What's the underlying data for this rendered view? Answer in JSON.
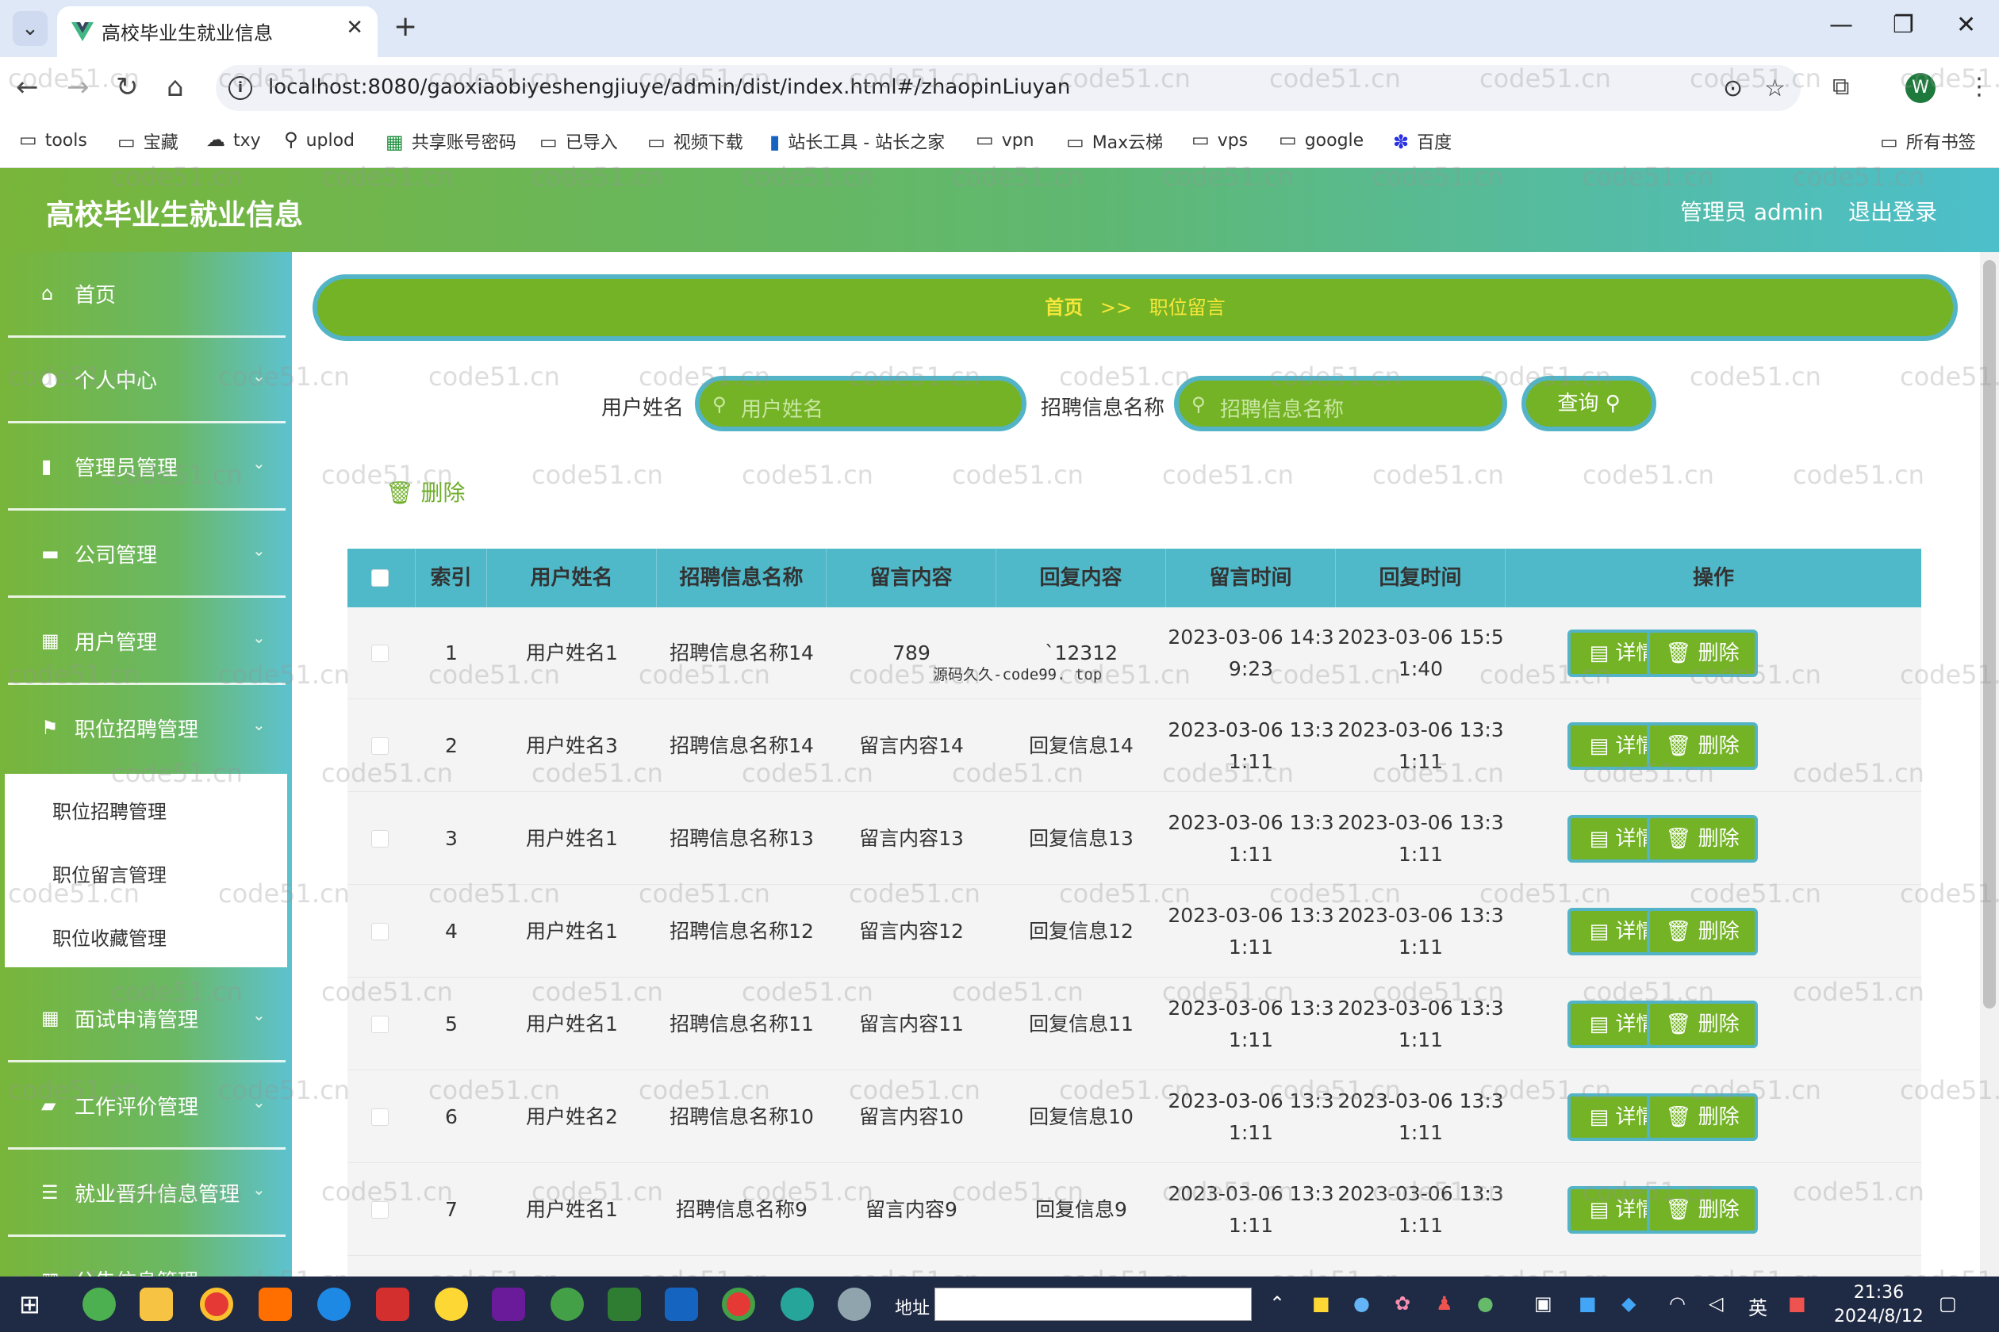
{
  "browser": {
    "tab_title": "高校毕业生就业信息",
    "url": "localhost:8080/gaoxiaobiyeshengjiuye/admin/dist/index.html#/zhaopinLiuyan",
    "bookmarks": [
      "tools",
      "宝藏",
      "txy",
      "uplod",
      "共享账号密码",
      "已导入",
      "视频下载",
      "站长工具 - 站长之家",
      "vpn",
      "Max云梯",
      "vps",
      "google",
      "百度"
    ],
    "all_bookmarks": "所有书签",
    "profile_initial": "W"
  },
  "header": {
    "title": "高校毕业生就业信息",
    "admin_label": "管理员 admin",
    "logout": "退出登录"
  },
  "sidebar": {
    "items": [
      {
        "label": "首页",
        "icon": "home-icon"
      },
      {
        "label": "个人中心",
        "icon": "user-icon"
      },
      {
        "label": "管理员管理",
        "icon": "bar-chart-icon"
      },
      {
        "label": "公司管理",
        "icon": "monitor-icon"
      },
      {
        "label": "用户管理",
        "icon": "grid-icon"
      },
      {
        "label": "职位招聘管理",
        "icon": "flag-icon"
      },
      {
        "label": "面试申请管理",
        "icon": "grid-icon"
      },
      {
        "label": "工作评价管理",
        "icon": "ticket-icon"
      },
      {
        "label": "就业晋升信息管理",
        "icon": "list-icon"
      },
      {
        "label": "公告信息管理",
        "icon": "grid-icon"
      }
    ],
    "submenu": [
      "职位招聘管理",
      "职位留言管理",
      "职位收藏管理"
    ]
  },
  "breadcrumb": {
    "home": "首页",
    "separator": ">>",
    "current": "职位留言"
  },
  "search": {
    "user_label": "用户姓名",
    "user_placeholder": "用户姓名",
    "job_label": "招聘信息名称",
    "job_placeholder": "招聘信息名称",
    "query_label": "查询"
  },
  "toolbar": {
    "delete_label": "删除"
  },
  "table": {
    "headers": [
      "索引",
      "用户姓名",
      "招聘信息名称",
      "留言内容",
      "回复内容",
      "留言时间",
      "回复时间",
      "操作"
    ],
    "detail_label": "详情",
    "delete_label": "删除",
    "rows": [
      {
        "index": "1",
        "user": "用户姓名1",
        "job": "招聘信息名称14",
        "message": "789",
        "reply": "`12312",
        "msg_time_1": "2023-03-06 14:3",
        "msg_time_2": "9:23",
        "reply_time_1": "2023-03-06 15:5",
        "reply_time_2": "1:40"
      },
      {
        "index": "2",
        "user": "用户姓名3",
        "job": "招聘信息名称14",
        "message": "留言内容14",
        "reply": "回复信息14",
        "msg_time_1": "2023-03-06 13:3",
        "msg_time_2": "1:11",
        "reply_time_1": "2023-03-06 13:3",
        "reply_time_2": "1:11"
      },
      {
        "index": "3",
        "user": "用户姓名1",
        "job": "招聘信息名称13",
        "message": "留言内容13",
        "reply": "回复信息13",
        "msg_time_1": "2023-03-06 13:3",
        "msg_time_2": "1:11",
        "reply_time_1": "2023-03-06 13:3",
        "reply_time_2": "1:11"
      },
      {
        "index": "4",
        "user": "用户姓名1",
        "job": "招聘信息名称12",
        "message": "留言内容12",
        "reply": "回复信息12",
        "msg_time_1": "2023-03-06 13:3",
        "msg_time_2": "1:11",
        "reply_time_1": "2023-03-06 13:3",
        "reply_time_2": "1:11"
      },
      {
        "index": "5",
        "user": "用户姓名1",
        "job": "招聘信息名称11",
        "message": "留言内容11",
        "reply": "回复信息11",
        "msg_time_1": "2023-03-06 13:3",
        "msg_time_2": "1:11",
        "reply_time_1": "2023-03-06 13:3",
        "reply_time_2": "1:11"
      },
      {
        "index": "6",
        "user": "用户姓名2",
        "job": "招聘信息名称10",
        "message": "留言内容10",
        "reply": "回复信息10",
        "msg_time_1": "2023-03-06 13:3",
        "msg_time_2": "1:11",
        "reply_time_1": "2023-03-06 13:3",
        "reply_time_2": "1:11"
      },
      {
        "index": "7",
        "user": "用户姓名1",
        "job": "招聘信息名称9",
        "message": "留言内容9",
        "reply": "回复信息9",
        "msg_time_1": "2023-03-06 13:3",
        "msg_time_2": "1:11",
        "reply_time_1": "2023-03-06 13:3",
        "reply_time_2": "1:11"
      }
    ]
  },
  "watermark": {
    "text": "code51.cn",
    "inline_text": "源码久久-code99. top"
  },
  "taskbar": {
    "address_label": "地址",
    "time": "21:36",
    "date": "2024/8/12",
    "ime": "英"
  },
  "colors": {
    "primary_green": "#74b326",
    "accent_cyan": "#52b4c6",
    "breadcrumb_text": "#f6e73a",
    "table_header": "#4fb8c9"
  }
}
